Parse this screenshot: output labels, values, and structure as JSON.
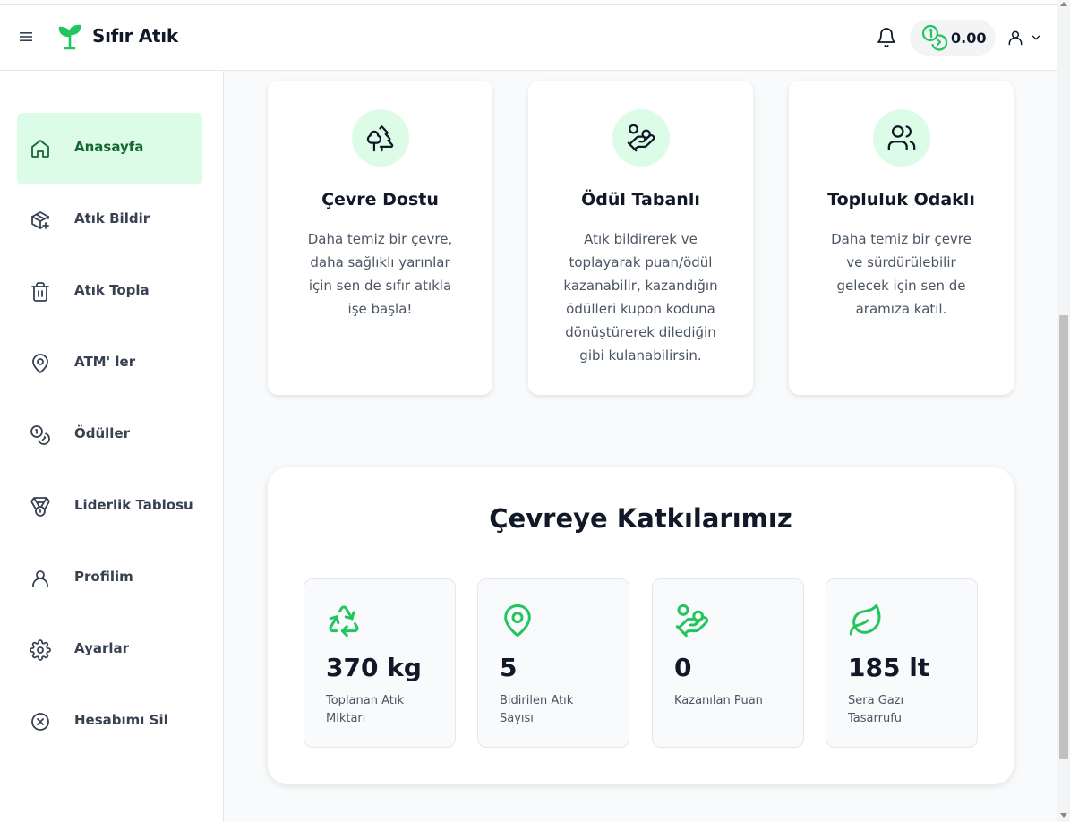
{
  "app": {
    "brand": "Sıfır Atık",
    "balance": "0.00"
  },
  "sidebar": {
    "items": [
      {
        "label": "Anasayfa",
        "icon": "home-icon",
        "active": true
      },
      {
        "label": "Atık Bildir",
        "icon": "box-plus-icon",
        "active": false
      },
      {
        "label": "Atık Topla",
        "icon": "trash-icon",
        "active": false
      },
      {
        "label": "ATM' ler",
        "icon": "map-pin-icon",
        "active": false
      },
      {
        "label": "Ödüller",
        "icon": "coins-icon",
        "active": false
      },
      {
        "label": "Liderlik Tablosu",
        "icon": "medal-icon",
        "active": false
      },
      {
        "label": "Profilim",
        "icon": "user-icon",
        "active": false
      },
      {
        "label": "Ayarlar",
        "icon": "gear-icon",
        "active": false
      },
      {
        "label": "Hesabımı Sil",
        "icon": "circle-x-icon",
        "active": false
      }
    ]
  },
  "features": [
    {
      "title": "Çevre Dostu",
      "desc": "Daha temiz bir çevre, daha sağlıklı yarınlar için sen de sıfır atıkla işe başla!",
      "icon": "trees-icon"
    },
    {
      "title": "Ödül Tabanlı",
      "desc": "Atık bildirerek ve toplayarak puan/ödül kazanabilir, kazandığın ödülleri kupon koduna dönüştürerek dilediğin gibi kulanabilirsin.",
      "icon": "hand-coins-icon"
    },
    {
      "title": "Topluluk Odaklı",
      "desc": "Daha temiz bir çevre ve sürdürülebilir gelecek için sen de aramıza katıl.",
      "icon": "users-icon"
    }
  ],
  "stats": {
    "title": "Çevreye Katkılarımız",
    "items": [
      {
        "value": "370 kg",
        "label": "Toplanan Atık Miktarı",
        "icon": "recycle-icon"
      },
      {
        "value": "5",
        "label": "Bidirilen Atık Sayısı",
        "icon": "map-pin-icon"
      },
      {
        "value": "0",
        "label": "Kazanılan Puan",
        "icon": "hand-coins-icon"
      },
      {
        "value": "185 lt",
        "label": "Sera Gazı Tasarrufu",
        "icon": "leaf-icon"
      }
    ]
  },
  "colors": {
    "accent": "#22c55e",
    "accent_light": "#dcfce7",
    "active_text": "#166534"
  }
}
